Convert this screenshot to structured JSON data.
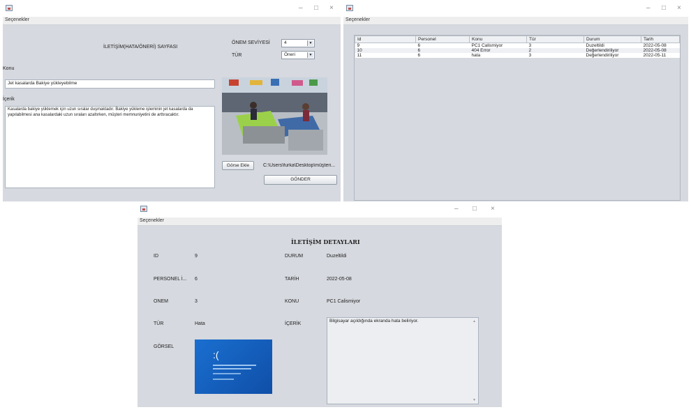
{
  "common": {
    "menu_label": "Seçenekler",
    "minimize": "–",
    "maximize": "□",
    "close": "×"
  },
  "form_window": {
    "heading": "İLETİŞİM(HATA/ÖNERİ)  SAYFASI",
    "priority_label": "ÖNEM SEVİYESİ",
    "priority_value": "4",
    "type_label": "TÜR",
    "type_value": "Öneri",
    "subject_label": "Konu",
    "subject_value": "Jet kasalarda Bakiye yükleyebilme",
    "content_label": "İçerik",
    "content_value": "Kasalarda bakiye yüklemek için uzun sıralar duşmaktadır. Bakiye yükleme işleminin jet kasalarda da yapılabilmesi ana kasalardaki uzun sıraları azaltırken, müşteri memnuniyetini de arttıracaktır.",
    "add_image_button": "Görse Ekle",
    "file_path": "C:\\Users\\furka\\Desktop\\müşteri...",
    "send_button": "GÖNDER"
  },
  "list_window": {
    "columns": [
      "Id",
      "Personel",
      "Konu",
      "Tür",
      "Durum",
      "Tarih"
    ],
    "rows": [
      [
        "9",
        "6",
        "PC1 Calismiyor",
        "3",
        "Duzeltildi",
        "2022-05-08"
      ],
      [
        "10",
        "6",
        "404 Error",
        "2",
        "Değerlendiriliyor",
        "2022-05-08"
      ],
      [
        "11",
        "6",
        "hata",
        "3",
        "Değerlendiriliyor",
        "2022-05-11"
      ]
    ]
  },
  "detail_window": {
    "heading": "İLETİŞİM DETAYLARI",
    "id_label": "ID",
    "id_value": "9",
    "personnel_label": "PERSONEL İ...",
    "personnel_value": "6",
    "priority_label": "ONEM",
    "priority_value": "3",
    "type_label": "TÜR",
    "type_value": "Hata",
    "image_label": "GÖRSEL",
    "status_label": "DURUM",
    "status_value": "Duzeltildi",
    "date_label": "TARİH",
    "date_value": "2022-05-08",
    "subject_label": "KONU",
    "subject_value": "PC1 Calismiyor",
    "content_label": "İÇERİK",
    "content_value": "Bilgisayar açıldığında ekranda hata beliriyor.",
    "bsod_face": ":("
  }
}
